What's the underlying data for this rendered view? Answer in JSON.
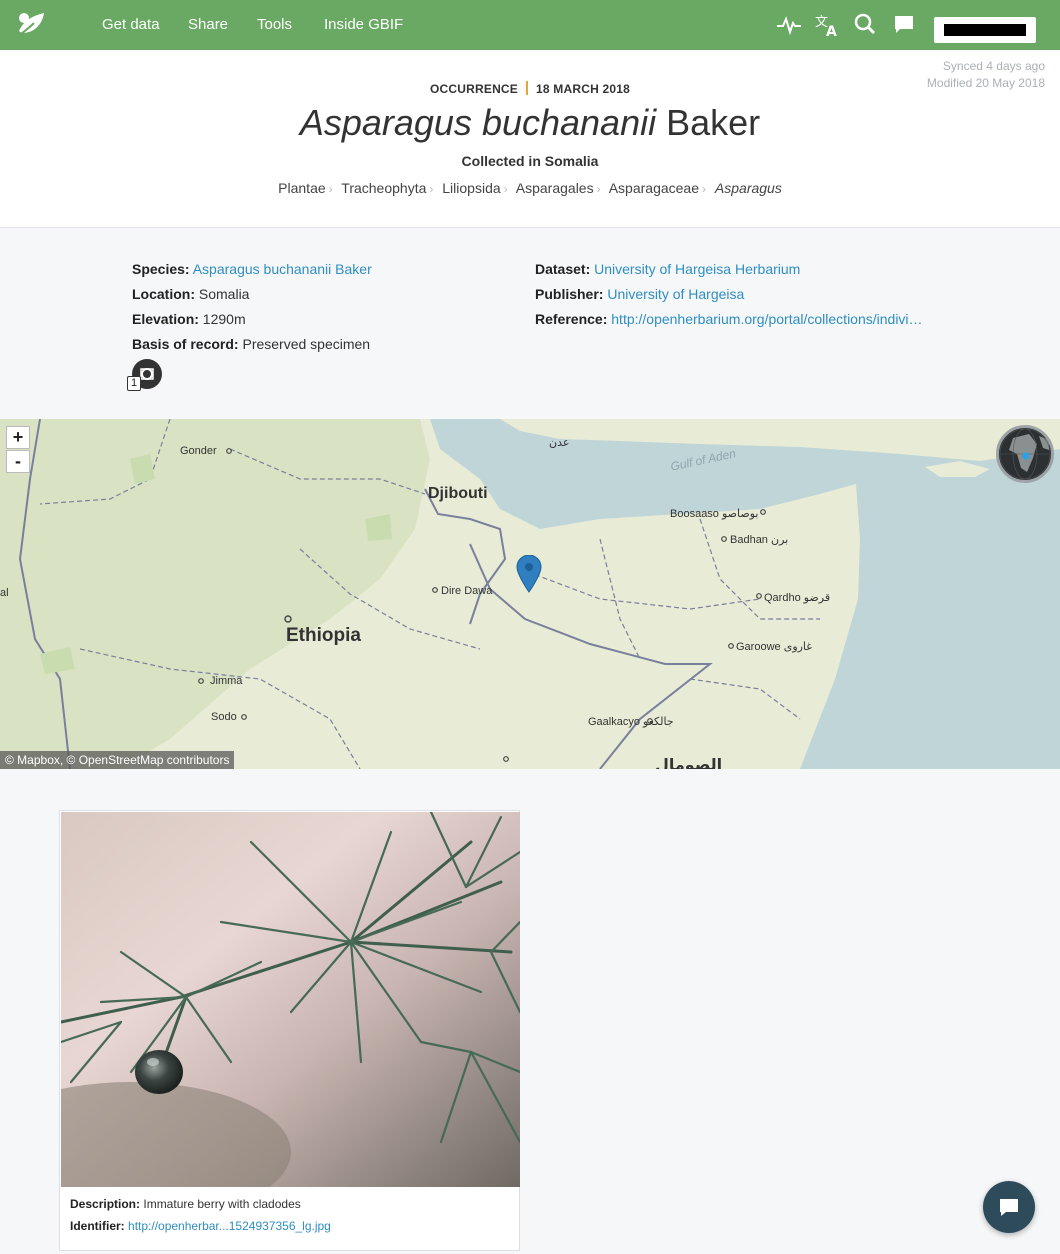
{
  "nav": {
    "items": [
      "Get data",
      "Share",
      "Tools",
      "Inside GBIF"
    ],
    "icons": [
      "activity-icon",
      "translate-icon",
      "search-icon",
      "feedback-icon"
    ],
    "accent_color": "#6aa964"
  },
  "header": {
    "synced": "Synced 4 days ago",
    "modified": "Modified 20 May 2018",
    "kicker_type": "OCCURRENCE",
    "kicker_date": "18 MARCH 2018",
    "title_italic": "Asparagus buchananii",
    "title_author": "Baker",
    "subtitle": "Collected in Somalia",
    "taxonomy": [
      "Plantae",
      "Tracheophyta",
      "Liliopsida",
      "Asparagales",
      "Asparagaceae",
      "Asparagus"
    ]
  },
  "summary": {
    "species_label": "Species:",
    "species_value": "Asparagus buchananii Baker",
    "location_label": "Location:",
    "location_value": "Somalia",
    "elevation_label": "Elevation:",
    "elevation_value": "1290m",
    "basis_label": "Basis of record:",
    "basis_value": "Preserved specimen",
    "dataset_label": "Dataset:",
    "dataset_value": "University of Hargeisa Herbarium",
    "publisher_label": "Publisher:",
    "publisher_value": "University of Hargeisa",
    "reference_label": "Reference:",
    "reference_value": "http://openherbarium.org/portal/collections/indivi…",
    "image_count": "1"
  },
  "map": {
    "zoom_in": "+",
    "zoom_out": "-",
    "attribution": "© Mapbox, © OpenStreetMap contributors",
    "labels": {
      "aden": "عدن",
      "gulf": "Gulf of Aden",
      "gonder": "Gonder",
      "djibouti": "Djibouti",
      "boosaaso": "Boosaaso بوصاصو",
      "badhan": "Badhan برن",
      "dire_dawa": "Dire Dawa",
      "qardho": "Qardho قرضو",
      "ethiopia": "Ethiopia",
      "garoowe": "Garoowe غاروى",
      "jimma": "Jimma",
      "sodo": "Sodo",
      "gaalkacyo": "Gaalkacyo جالكعو",
      "edge_left": "al",
      "bottom_arabic": "الصومال"
    }
  },
  "media": {
    "description_label": "Description:",
    "description_value": "Immature berry with cladodes",
    "identifier_label": "Identifier:",
    "identifier_value": "http://openherbar...1524937356_lg.jpg"
  }
}
